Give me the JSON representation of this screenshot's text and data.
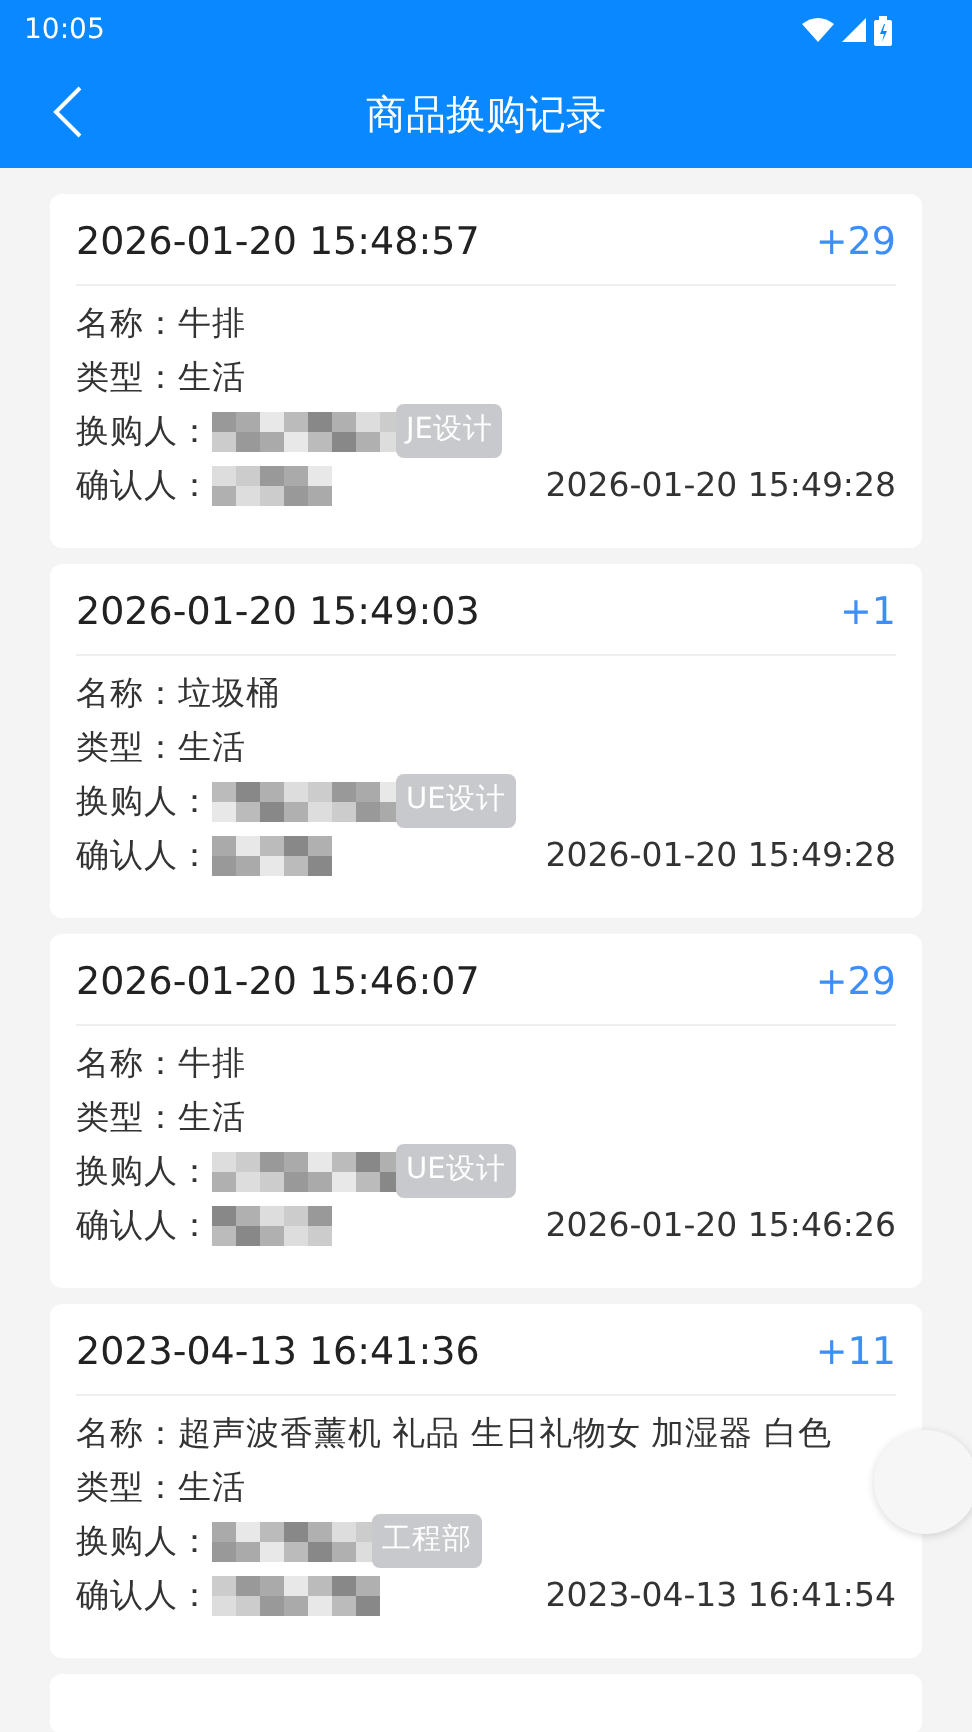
{
  "status_bar": {
    "time": "10:05"
  },
  "header": {
    "title": "商品换购记录"
  },
  "records": [
    {
      "time": "2026-01-20 15:48:57",
      "points": "+29",
      "fields": [
        {
          "label": "名称：",
          "value": "牛排"
        },
        {
          "label": "类型：",
          "value": "生活"
        }
      ],
      "buyer_label": "换购人：",
      "buyer_tag": "JE设计",
      "confirmer_label": "确认人：",
      "confirm_time": "2026-01-20 15:49:28"
    },
    {
      "time": "2026-01-20 15:49:03",
      "points": "+1",
      "fields": [
        {
          "label": "名称：",
          "value": "垃圾桶"
        },
        {
          "label": "类型：",
          "value": "生活"
        }
      ],
      "buyer_label": "换购人：",
      "buyer_tag": "UE设计",
      "confirmer_label": "确认人：",
      "confirm_time": "2026-01-20 15:49:28"
    },
    {
      "time": "2026-01-20 15:46:07",
      "points": "+29",
      "fields": [
        {
          "label": "名称：",
          "value": "牛排"
        },
        {
          "label": "类型：",
          "value": "生活"
        }
      ],
      "buyer_label": "换购人：",
      "buyer_tag": "UE设计",
      "confirmer_label": "确认人：",
      "confirm_time": "2026-01-20 15:46:26"
    },
    {
      "time": "2023-04-13 16:41:36",
      "points": "+11",
      "fields": [
        {
          "label": "名称：",
          "value": "超声波香薰机 礼品 生日礼物女 加湿器 白色"
        },
        {
          "label": "类型：",
          "value": "生活"
        }
      ],
      "buyer_label": "换购人：",
      "buyer_tag": "工程部",
      "confirmer_label": "确认人：",
      "confirm_time": "2023-04-13 16:41:54"
    }
  ]
}
